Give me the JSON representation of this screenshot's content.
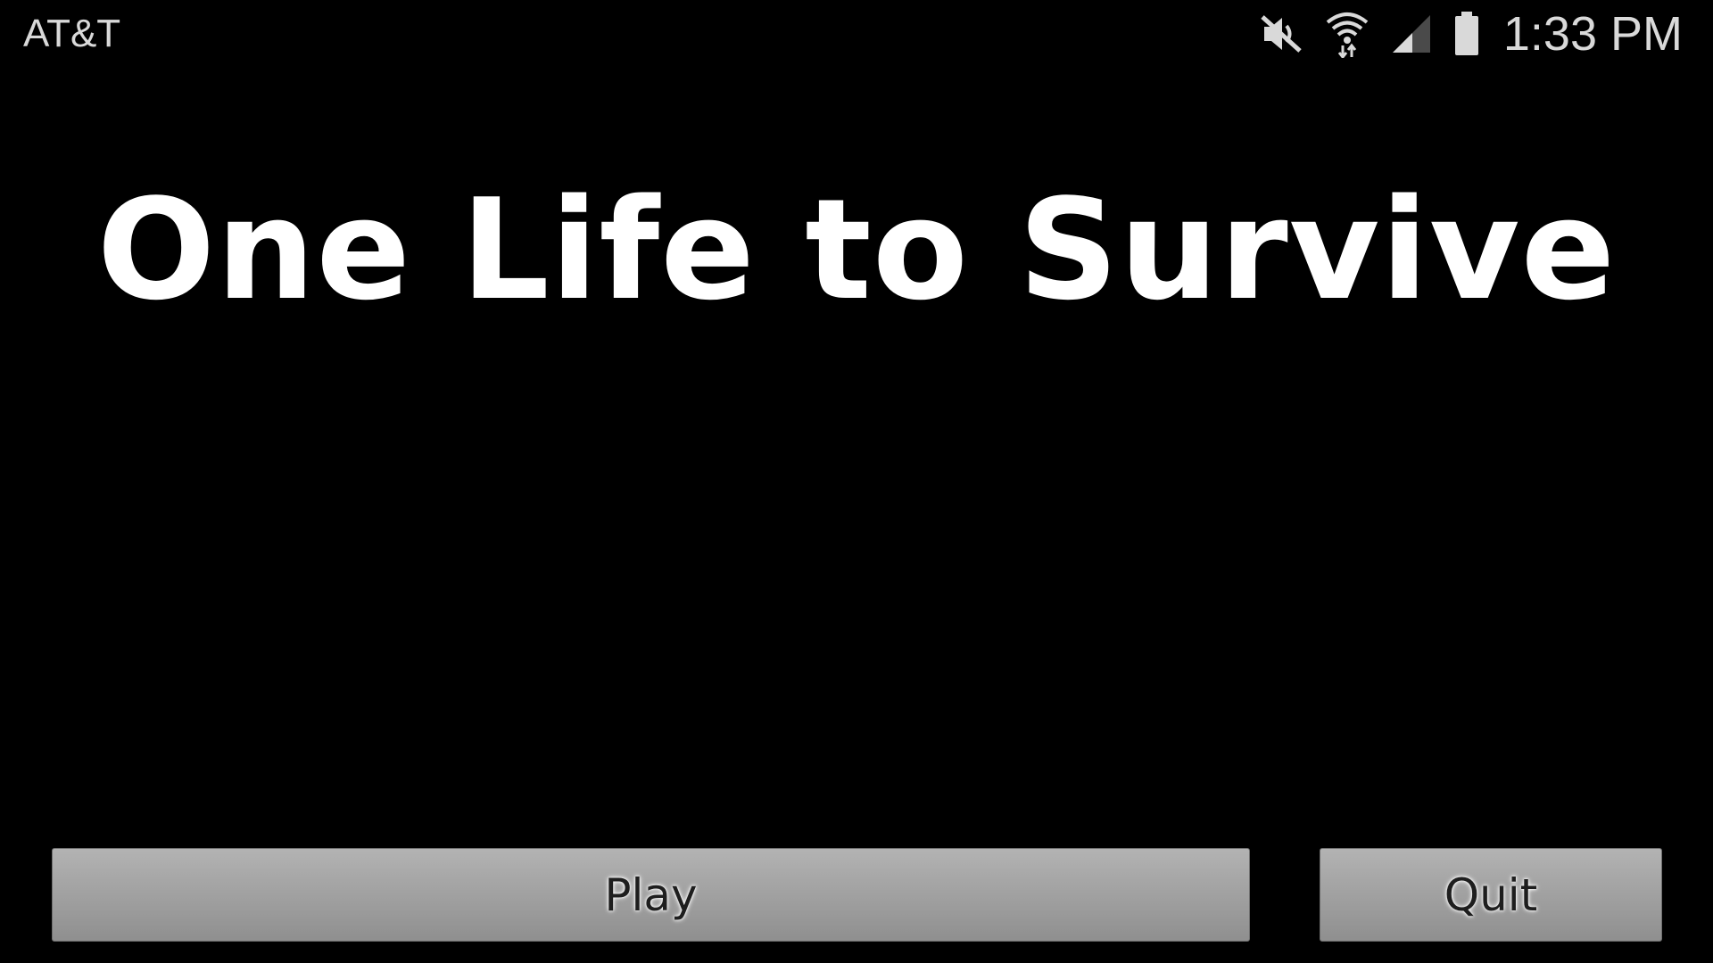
{
  "status_bar": {
    "carrier": "AT&T",
    "time": "1:33 PM",
    "icons": [
      "mute-icon",
      "wifi-icon",
      "signal-icon",
      "battery-icon"
    ]
  },
  "game": {
    "title": "One Life to Survive"
  },
  "buttons": {
    "play_label": "Play",
    "quit_label": "Quit"
  },
  "colors": {
    "background": "#000000",
    "title": "#ffffff",
    "button": "#a6a6a6",
    "status_text": "#d9d9d9"
  }
}
